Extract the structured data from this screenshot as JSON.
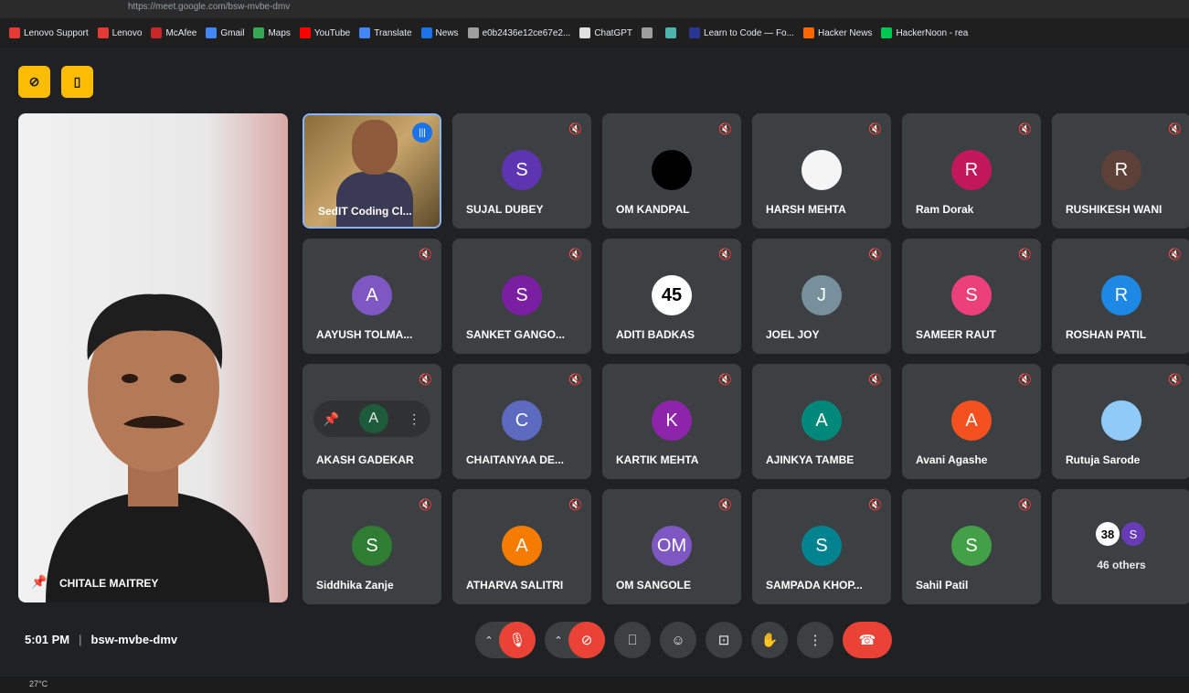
{
  "browser": {
    "url": "https://meet.google.com/bsw-mvbe-dmv",
    "bookmarks": [
      {
        "label": "Lenovo Support",
        "color": "#e53935"
      },
      {
        "label": "Lenovo",
        "color": "#e53935"
      },
      {
        "label": "McAfee",
        "color": "#c62828"
      },
      {
        "label": "Gmail",
        "color": "#4285f4"
      },
      {
        "label": "Maps",
        "color": "#34a853"
      },
      {
        "label": "YouTube",
        "color": "#ff0000"
      },
      {
        "label": "Translate",
        "color": "#4285f4"
      },
      {
        "label": "News",
        "color": "#1a73e8"
      },
      {
        "label": "e0b2436e12ce67e2...",
        "color": "#9e9e9e"
      },
      {
        "label": "ChatGPT",
        "color": "#e0e0e0"
      },
      {
        "label": "",
        "color": "#9e9e9e"
      },
      {
        "label": "",
        "color": "#4db6ac"
      },
      {
        "label": "Learn to Code — Fo...",
        "color": "#283593"
      },
      {
        "label": "Hacker News",
        "color": "#ff6600"
      },
      {
        "label": "HackerNoon - rea",
        "color": "#00c853"
      }
    ]
  },
  "pinned": {
    "name": "CHITALE MAITREY"
  },
  "tiles": [
    {
      "name": "SedIT Coding Cl...",
      "type": "video"
    },
    {
      "name": "SUJAL DUBEY",
      "initial": "S",
      "color": "#5e35b1"
    },
    {
      "name": "OM KANDPAL",
      "initial": "",
      "color": "#000000"
    },
    {
      "name": "HARSH MEHTA",
      "initial": "",
      "color": "#f5f5f5"
    },
    {
      "name": "Ram Dorak",
      "initial": "R",
      "color": "#c2185b"
    },
    {
      "name": "RUSHIKESH WANI",
      "initial": "R",
      "color": "#5d4037"
    },
    {
      "name": "AAYUSH TOLMA...",
      "initial": "A",
      "color": "#7e57c2"
    },
    {
      "name": "SANKET GANGO...",
      "initial": "S",
      "color": "#7b1fa2"
    },
    {
      "name": "ADITI BADKAS",
      "initial": "45",
      "color": "#ffffff"
    },
    {
      "name": "JOEL JOY",
      "initial": "J",
      "color": "#78909c"
    },
    {
      "name": "SAMEER RAUT",
      "initial": "S",
      "color": "#ec407a"
    },
    {
      "name": "ROSHAN PATIL",
      "initial": "R",
      "color": "#1e88e5"
    },
    {
      "name": "AKASH GADEKAR",
      "initial": "A",
      "color": "#1e5b3a",
      "hover": true
    },
    {
      "name": "CHAITANYAA DE...",
      "initial": "C",
      "color": "#5c6bc0"
    },
    {
      "name": "KARTIK MEHTA",
      "initial": "K",
      "color": "#8e24aa"
    },
    {
      "name": "AJINKYA TAMBE",
      "initial": "A",
      "color": "#00897b"
    },
    {
      "name": "Avani Agashe",
      "initial": "A",
      "color": "#f4511e"
    },
    {
      "name": "Rutuja Sarode",
      "initial": "",
      "color": "#90caf9"
    },
    {
      "name": "Siddhika Zanje",
      "initial": "S",
      "color": "#2e7d32"
    },
    {
      "name": "ATHARVA SALITRI",
      "initial": "A",
      "color": "#f57c00"
    },
    {
      "name": "OM SANGOLE",
      "initial": "OM",
      "color": "#7e57c2"
    },
    {
      "name": "SAMPADA KHOP...",
      "initial": "S",
      "color": "#00838f"
    },
    {
      "name": "Sahil Patil",
      "initial": "S",
      "color": "#43a047"
    },
    {
      "name": "46 others",
      "type": "others",
      "a1": "38",
      "a2": "S"
    }
  ],
  "bottom": {
    "time": "5:01 PM",
    "separator": "|",
    "meeting_code": "bsw-mvbe-dmv"
  },
  "taskbar": {
    "temp": "27°C"
  }
}
